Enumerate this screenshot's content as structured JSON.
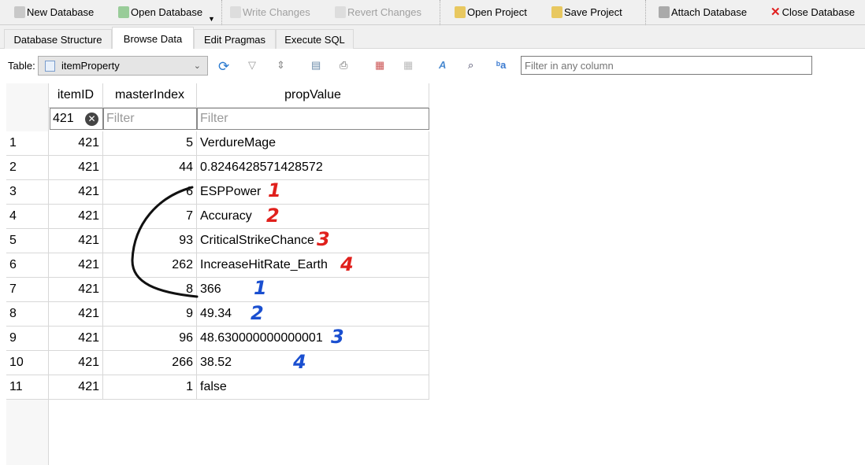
{
  "toolbar": {
    "new_db": "New Database",
    "open_db": "Open Database",
    "write": "Write Changes",
    "revert": "Revert Changes",
    "open_proj": "Open Project",
    "save_proj": "Save Project",
    "attach": "Attach Database",
    "close": "Close Database"
  },
  "tabs": [
    "Database Structure",
    "Browse Data",
    "Edit Pragmas",
    "Execute SQL"
  ],
  "browse": {
    "table_label": "Table:",
    "table_value": "itemProperty",
    "filter_any_placeholder": "Filter in any column"
  },
  "grid": {
    "columns": [
      "itemID",
      "masterIndex",
      "propValue"
    ],
    "filters": {
      "itemID": "421",
      "masterIndex_placeholder": "Filter",
      "propValue_placeholder": "Filter"
    },
    "rows": [
      [
        "1",
        "421",
        "5",
        "VerdureMage"
      ],
      [
        "2",
        "421",
        "44",
        "0.8246428571428572"
      ],
      [
        "3",
        "421",
        "6",
        "ESPPower"
      ],
      [
        "4",
        "421",
        "7",
        "Accuracy"
      ],
      [
        "5",
        "421",
        "93",
        "CriticalStrikeChance"
      ],
      [
        "6",
        "421",
        "262",
        "IncreaseHitRate_Earth"
      ],
      [
        "7",
        "421",
        "8",
        "366"
      ],
      [
        "8",
        "421",
        "9",
        "49.34"
      ],
      [
        "9",
        "421",
        "96",
        "48.630000000000001"
      ],
      [
        "10",
        "421",
        "266",
        "38.52"
      ],
      [
        "11",
        "421",
        "1",
        "false"
      ]
    ]
  },
  "annotations": {
    "red": [
      "1",
      "2",
      "3",
      "4"
    ],
    "blue": [
      "1",
      "2",
      "3",
      "4"
    ],
    "red_color": "#e0201c",
    "blue_color": "#1a4fd0"
  }
}
